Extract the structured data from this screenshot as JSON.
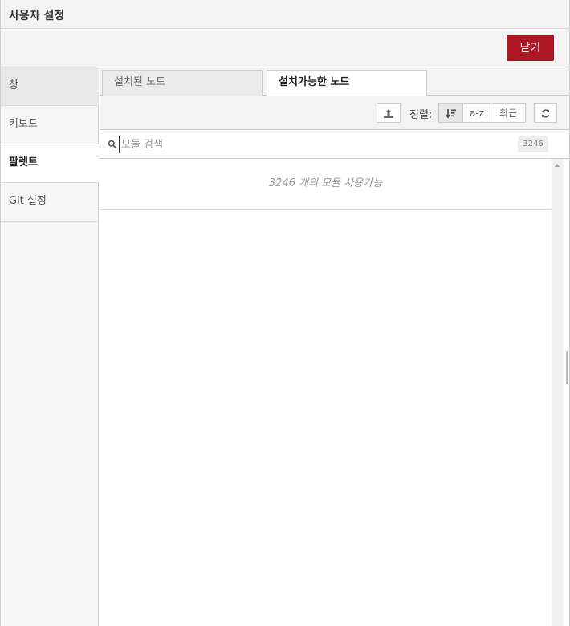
{
  "dialog": {
    "title": "사용자 설정",
    "close_label": "닫기"
  },
  "sidebar": {
    "items": [
      {
        "label": "창"
      },
      {
        "label": "키보드"
      },
      {
        "label": "팔렛트"
      },
      {
        "label": "Git 설정"
      }
    ],
    "active_index": 2
  },
  "tabs": [
    {
      "label": "설치된 노드"
    },
    {
      "label": "설치가능한 노드"
    }
  ],
  "toolbar": {
    "sort_label": "정렬:",
    "sort_az": "a-z",
    "sort_recent": "최근"
  },
  "search": {
    "placeholder": "모듈 검색",
    "value": "",
    "count": "3246"
  },
  "modules": {
    "available_message": "3246 개의 모듈 사용가능"
  },
  "colors": {
    "primary_button": "#ad1625",
    "panel_bg": "#f3f3f3",
    "border": "#cccccc"
  },
  "icons": {
    "upload": "upload-icon",
    "sort_relevance": "sort-relevance-icon",
    "refresh": "refresh-icon",
    "search": "search-icon"
  }
}
